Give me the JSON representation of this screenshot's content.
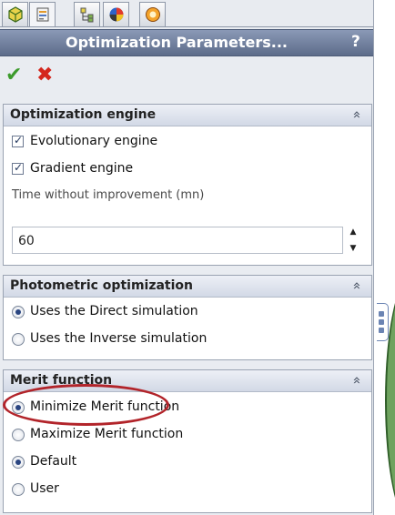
{
  "tabs": [
    {
      "icon": "feature-manager-icon"
    },
    {
      "icon": "property-manager-icon",
      "active": true
    },
    {
      "icon": "configuration-manager-icon"
    },
    {
      "icon": "display-manager-icon"
    },
    {
      "icon": "render-icon"
    }
  ],
  "header": {
    "title": "Optimization Parameters...",
    "help": "?"
  },
  "actions": {
    "ok": "✔",
    "cancel": "✖"
  },
  "optimization_engine": {
    "title": "Optimization engine",
    "collapse": "«",
    "evolutionary": {
      "label": "Evolutionary engine",
      "checked": true
    },
    "gradient": {
      "label": "Gradient engine",
      "checked": true
    },
    "time_label": "Time without improvement (mn)",
    "time_value": "60",
    "spin_up": "▲",
    "spin_down": "▼"
  },
  "photometric": {
    "title": "Photometric optimization",
    "collapse": "«",
    "options": [
      {
        "label": "Uses the Direct simulation",
        "selected": true
      },
      {
        "label": "Uses the Inverse simulation",
        "selected": false
      }
    ]
  },
  "merit": {
    "title": "Merit function",
    "collapse": "«",
    "options": [
      {
        "label": "Minimize Merit function",
        "selected": true
      },
      {
        "label": "Maximize Merit function",
        "selected": false
      },
      {
        "label": "Default",
        "selected": true
      },
      {
        "label": "User",
        "selected": false
      }
    ]
  },
  "colors": {
    "highlight": "#b2242a",
    "titlebar": "#6f7e9c",
    "ok": "#3c9b2c",
    "cancel": "#d4261c"
  }
}
